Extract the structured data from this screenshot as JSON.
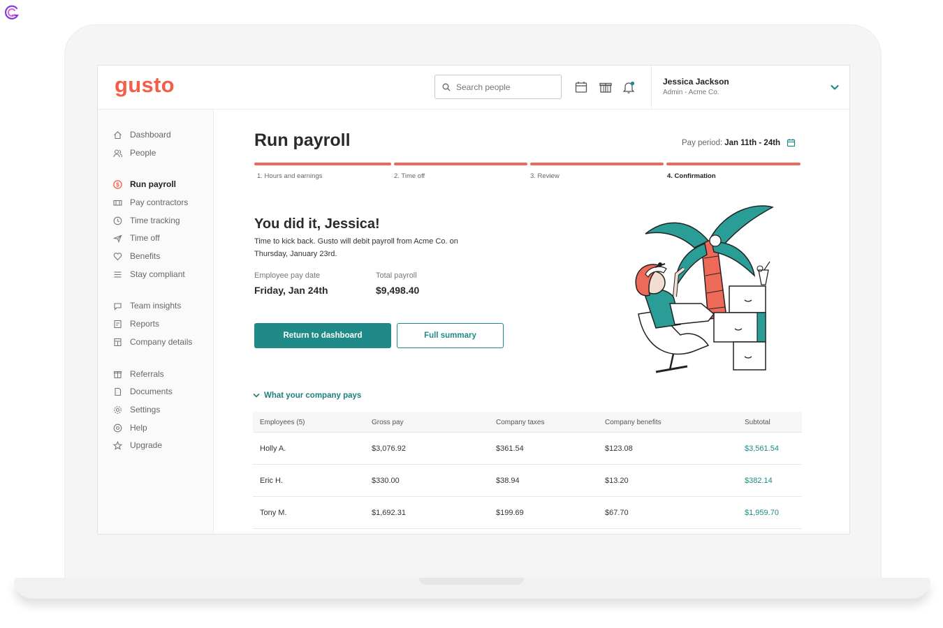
{
  "brand": "gusto",
  "search": {
    "placeholder": "Search people"
  },
  "user": {
    "name": "Jessica Jackson",
    "role": "Admin - Acme Co."
  },
  "sidebar": {
    "items": [
      {
        "label": "Dashboard",
        "icon": "home-icon"
      },
      {
        "label": "People",
        "icon": "people-icon"
      },
      {
        "label": "Run payroll",
        "icon": "dollar-icon",
        "active": true
      },
      {
        "label": "Pay contractors",
        "icon": "wallet-icon"
      },
      {
        "label": "Time tracking",
        "icon": "clock-icon"
      },
      {
        "label": "Time off",
        "icon": "plane-icon"
      },
      {
        "label": "Benefits",
        "icon": "heart-icon"
      },
      {
        "label": "Stay compliant",
        "icon": "list-icon"
      },
      {
        "label": "Team insights",
        "icon": "chat-icon"
      },
      {
        "label": "Reports",
        "icon": "report-icon"
      },
      {
        "label": "Company details",
        "icon": "building-icon"
      },
      {
        "label": "Referrals",
        "icon": "gift-icon"
      },
      {
        "label": "Documents",
        "icon": "document-icon"
      },
      {
        "label": "Settings",
        "icon": "gear-icon"
      },
      {
        "label": "Help",
        "icon": "help-icon"
      },
      {
        "label": "Upgrade",
        "icon": "star-icon"
      }
    ]
  },
  "main": {
    "title": "Run payroll",
    "pay_period_label": "Pay period:",
    "pay_period_value": "Jan 11th - 24th",
    "steps": [
      {
        "label": "1. Hours and earnings"
      },
      {
        "label": "2. Time off"
      },
      {
        "label": "3. Review"
      },
      {
        "label": "4. Confirmation",
        "current": true
      }
    ],
    "headline": "You did it, Jessica!",
    "subtext": "Time to kick back. Gusto will debit payroll from Acme Co. on Thursday, January 23rd.",
    "employee_pay_date_label": "Employee pay date",
    "employee_pay_date": "Friday, Jan 24th",
    "total_payroll_label": "Total payroll",
    "total_payroll": "$9,498.40",
    "return_button": "Return to dashboard",
    "summary_button": "Full summary",
    "toggle_label": "What your company pays"
  },
  "table": {
    "headers": [
      "Employees (5)",
      "Gross pay",
      "Company taxes",
      "Company benefits",
      "Subtotal"
    ],
    "rows": [
      [
        "Holly A.",
        "$3,076.92",
        "$361.54",
        "$123.08",
        "$3,561.54"
      ],
      [
        "Eric H.",
        "$330.00",
        "$38.94",
        "$13.20",
        "$382.14"
      ],
      [
        "Tony M.",
        "$1,692.31",
        "$199.69",
        "$67.70",
        "$1,959.70"
      ]
    ]
  },
  "colors": {
    "brand": "#f45d48",
    "accent": "#1f8a87",
    "progress": "#ee6a58"
  }
}
